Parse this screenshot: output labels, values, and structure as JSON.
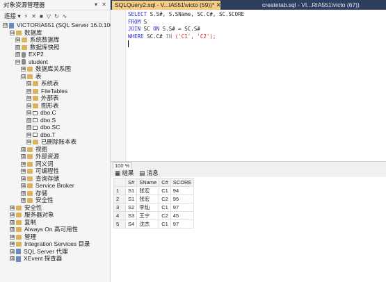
{
  "object_explorer": {
    "title": "对象资源管理器",
    "title_buttons": "▾ ✕",
    "toolbar": {
      "connect": "连接 ▾"
    },
    "tree": [
      {
        "label": "VICTORIA551 (SQL Server 16.0.1000.6",
        "icon": "server-icon",
        "expander": "⊟"
      },
      {
        "label": "数据库",
        "icon": "folder-icon",
        "expander": "⊟"
      },
      {
        "label": "系统数据库",
        "icon": "folder-icon",
        "expander": "⊞"
      },
      {
        "label": "数据库快照",
        "icon": "folder-icon",
        "expander": "⊞"
      },
      {
        "label": "EXP2",
        "icon": "database-icon",
        "expander": "⊞"
      },
      {
        "label": "student",
        "icon": "database-icon",
        "expander": "⊟"
      },
      {
        "label": "数据库关系图",
        "icon": "folder-icon",
        "expander": "⊞"
      },
      {
        "label": "表",
        "icon": "folder-icon",
        "expander": "⊟"
      },
      {
        "label": "系统表",
        "icon": "folder-icon",
        "expander": "⊞"
      },
      {
        "label": "FileTables",
        "icon": "folder-icon",
        "expander": "⊞"
      },
      {
        "label": "外部表",
        "icon": "folder-icon",
        "expander": "⊞"
      },
      {
        "label": "图形表",
        "icon": "folder-icon",
        "expander": "⊞"
      },
      {
        "label": "dbo.C",
        "icon": "table-icon",
        "expander": "⊞"
      },
      {
        "label": "dbo.S",
        "icon": "table-icon",
        "expander": "⊞"
      },
      {
        "label": "dbo.SC",
        "icon": "table-icon",
        "expander": "⊞"
      },
      {
        "label": "dbo.T",
        "icon": "table-icon",
        "expander": "⊞"
      },
      {
        "label": "已删除账本表",
        "icon": "folder-icon",
        "expander": "⊞"
      },
      {
        "label": "视图",
        "icon": "folder-icon",
        "expander": "⊞"
      },
      {
        "label": "外部资源",
        "icon": "folder-icon",
        "expander": "⊞"
      },
      {
        "label": "同义词",
        "icon": "folder-icon",
        "expander": "⊞"
      },
      {
        "label": "可编程性",
        "icon": "folder-icon",
        "expander": "⊞"
      },
      {
        "label": "查询存储",
        "icon": "folder-icon",
        "expander": "⊞"
      },
      {
        "label": "Service Broker",
        "icon": "folder-icon",
        "expander": "⊞"
      },
      {
        "label": "存储",
        "icon": "folder-icon",
        "expander": "⊞"
      },
      {
        "label": "安全性",
        "icon": "folder-icon",
        "expander": "⊞"
      },
      {
        "label": "安全性",
        "icon": "folder-icon",
        "expander": "⊞"
      },
      {
        "label": "服务器对象",
        "icon": "folder-icon",
        "expander": "⊞"
      },
      {
        "label": "复制",
        "icon": "folder-icon",
        "expander": "⊞"
      },
      {
        "label": "Always On 高可用性",
        "icon": "folder-icon",
        "expander": "⊞"
      },
      {
        "label": "管理",
        "icon": "folder-icon",
        "expander": "⊞"
      },
      {
        "label": "Integration Services 目录",
        "icon": "folder-icon",
        "expander": "⊞"
      },
      {
        "label": "SQL Server 代理",
        "icon": "agent-icon",
        "expander": "⊞"
      },
      {
        "label": "XEvent 探查器",
        "icon": "xevent-icon",
        "expander": "⊞"
      }
    ]
  },
  "tabs": [
    {
      "label": "SQLQuery2.sql - V...IA551\\victo (59))*  ✕",
      "active": true
    },
    {
      "label": "createtab.sql - VI...RIA551\\victo (67))",
      "active": false
    }
  ],
  "editor": {
    "lines": [
      {
        "k1": "SELECT",
        "rest": " S.S#, S.SName, SC.C#, SC.SCORE"
      },
      {
        "k1": "FROM",
        "rest": " S"
      },
      {
        "k1": "JOIN",
        "rest": " SC ",
        "k2": "ON",
        "rest2": " S.S# = SC.S#"
      },
      {
        "k1": "WHERE",
        "rest": " SC.C# ",
        "k2": "IN",
        "str": " ('C1', 'C2');"
      }
    ]
  },
  "zoom": "100 %",
  "results_tabs": [
    "▦ 结果",
    "▤ 消息"
  ],
  "results": {
    "columns": [
      "S#",
      "SName",
      "C#",
      "SCORE"
    ],
    "rows": [
      {
        "num": "1",
        "cells": [
          "S1",
          "张宏",
          "C1",
          "94"
        ]
      },
      {
        "num": "2",
        "cells": [
          "S1",
          "张宏",
          "C2",
          "95"
        ]
      },
      {
        "num": "3",
        "cells": [
          "S2",
          "李灿",
          "C1",
          "97"
        ]
      },
      {
        "num": "4",
        "cells": [
          "S3",
          "王宁",
          "C2",
          "45"
        ]
      },
      {
        "num": "5",
        "cells": [
          "S4",
          "沈杰",
          "C1",
          "97"
        ]
      }
    ]
  }
}
